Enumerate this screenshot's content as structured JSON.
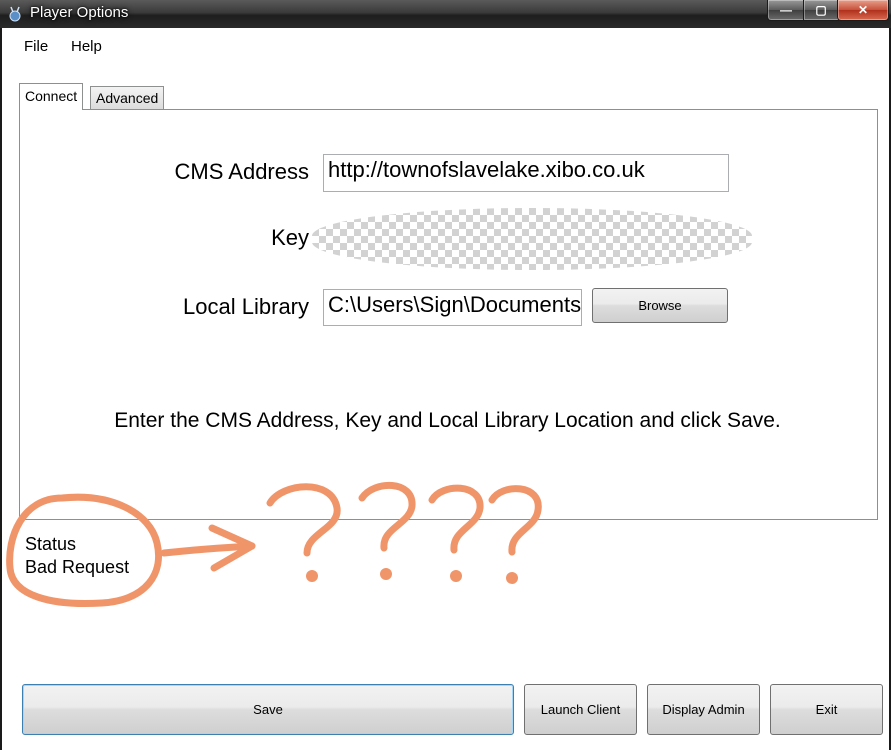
{
  "window": {
    "title": "Player Options",
    "controls": {
      "minimize": "—",
      "maximize": "▢",
      "close": "✕"
    }
  },
  "menu": {
    "file": "File",
    "help": "Help"
  },
  "tabs": {
    "connect": "Connect",
    "advanced": "Advanced"
  },
  "form": {
    "cms_label": "CMS Address",
    "cms_value": "http://townofslavelake.xibo.co.uk",
    "key_label": "Key",
    "library_label": "Local Library",
    "library_value": "C:\\Users\\Sign\\Documents",
    "browse_label": "Browse",
    "instructions": "Enter the CMS Address, Key and Local Library Location and click Save."
  },
  "status": {
    "label": "Status",
    "value": "Bad Request"
  },
  "buttons": {
    "save": "Save",
    "launch_client": "Launch Client",
    "display_admin": "Display Admin",
    "exit": "Exit"
  },
  "colors": {
    "annotation": "#f0956a",
    "focus_border": "#3c7fb1"
  },
  "annotation_text": "????"
}
